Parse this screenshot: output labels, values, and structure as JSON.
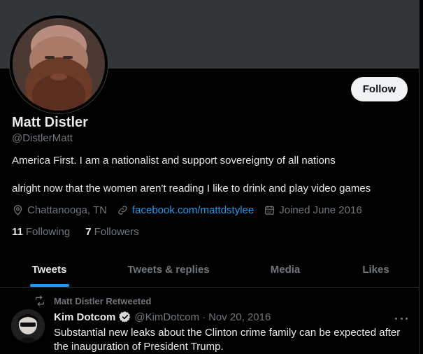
{
  "profile": {
    "name": "Matt Distler",
    "handle": "@DistlerMatt",
    "bio_line1": "America First. I am a nationalist and support sovereignty of all nations",
    "bio_line2": "alright now that the women aren't reading I like to drink and play video games",
    "location": "Chattanooga, TN",
    "website": "facebook.com/mattdstylee",
    "joined": "Joined June 2016",
    "following_count": "11",
    "following_label": "Following",
    "followers_count": "7",
    "followers_label": "Followers",
    "follow_label": "Follow"
  },
  "tabs": [
    {
      "label": "Tweets",
      "active": true
    },
    {
      "label": "Tweets & replies",
      "active": false
    },
    {
      "label": "Media",
      "active": false
    },
    {
      "label": "Likes",
      "active": false
    }
  ],
  "tweet": {
    "retweet_label": "Matt Distler Retweeted",
    "author_name": "Kim Dotcom",
    "author_handle": "@KimDotcom",
    "separator": "·",
    "date": "Nov 20, 2016",
    "text": "Substantial new leaks about the Clinton crime family can be expected after the inauguration of President Trump."
  },
  "colors": {
    "background": "#000000",
    "banner": "#333639",
    "accent": "#1d9bf0",
    "muted": "#71767b",
    "text": "#e7e9ea"
  },
  "icons": {
    "location": "location-pin-icon",
    "link": "link-icon",
    "calendar": "calendar-icon",
    "retweet": "retweet-icon",
    "verified": "verified-badge-icon",
    "more": "more-dots-icon"
  }
}
